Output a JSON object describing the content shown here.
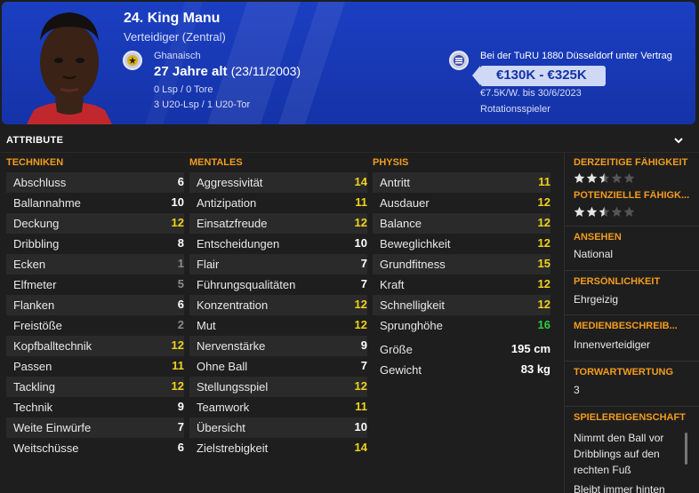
{
  "player": {
    "name": "24. King Manu",
    "position": "Verteidiger (Zentral)",
    "nationality": "Ghanaisch",
    "age": "27 Jahre alt",
    "dob": "(23/11/2003)",
    "caps_senior": "0 Lsp / 0 Tore",
    "caps_u20": "3 U20-Lsp / 1 U20-Tor",
    "contract": "Bei der TuRU 1880 Düsseldorf unter Vertrag",
    "value": "€130K - €325K",
    "wage": "€7.5K/W. bis 30/6/2023",
    "squad_role": "Rotationsspieler"
  },
  "section": {
    "title": "ATTRIBUTE"
  },
  "technical": {
    "header": "TECHNIKEN",
    "rows": [
      {
        "label": "Abschluss",
        "value": "6"
      },
      {
        "label": "Ballannahme",
        "value": "10"
      },
      {
        "label": "Deckung",
        "value": "12"
      },
      {
        "label": "Dribbling",
        "value": "8"
      },
      {
        "label": "Ecken",
        "value": "1"
      },
      {
        "label": "Elfmeter",
        "value": "5"
      },
      {
        "label": "Flanken",
        "value": "6"
      },
      {
        "label": "Freistöße",
        "value": "2"
      },
      {
        "label": "Kopfballtechnik",
        "value": "12"
      },
      {
        "label": "Passen",
        "value": "11"
      },
      {
        "label": "Tackling",
        "value": "12"
      },
      {
        "label": "Technik",
        "value": "9"
      },
      {
        "label": "Weite Einwürfe",
        "value": "7"
      },
      {
        "label": "Weitschüsse",
        "value": "6"
      }
    ]
  },
  "mental": {
    "header": "MENTALES",
    "rows": [
      {
        "label": "Aggressivität",
        "value": "14"
      },
      {
        "label": "Antizipation",
        "value": "11"
      },
      {
        "label": "Einsatzfreude",
        "value": "12"
      },
      {
        "label": "Entscheidungen",
        "value": "10"
      },
      {
        "label": "Flair",
        "value": "7"
      },
      {
        "label": "Führungsqualitäten",
        "value": "7"
      },
      {
        "label": "Konzentration",
        "value": "12"
      },
      {
        "label": "Mut",
        "value": "12"
      },
      {
        "label": "Nervenstärke",
        "value": "9"
      },
      {
        "label": "Ohne Ball",
        "value": "7"
      },
      {
        "label": "Stellungsspiel",
        "value": "12"
      },
      {
        "label": "Teamwork",
        "value": "11"
      },
      {
        "label": "Übersicht",
        "value": "10"
      },
      {
        "label": "Zielstrebigkeit",
        "value": "14"
      }
    ]
  },
  "physical": {
    "header": "PHYSIS",
    "rows": [
      {
        "label": "Antritt",
        "value": "11"
      },
      {
        "label": "Ausdauer",
        "value": "12"
      },
      {
        "label": "Balance",
        "value": "12"
      },
      {
        "label": "Beweglichkeit",
        "value": "12"
      },
      {
        "label": "Grundfitness",
        "value": "15"
      },
      {
        "label": "Kraft",
        "value": "12"
      },
      {
        "label": "Schnelligkeit",
        "value": "12"
      },
      {
        "label": "Sprunghöhe",
        "value": "16"
      }
    ],
    "height_label": "Größe",
    "height_value": "195 cm",
    "weight_label": "Gewicht",
    "weight_value": "83 kg"
  },
  "side": {
    "current_ability_label": "DERZEITIGE FÄHIGKEIT",
    "current_ability_stars": 2.5,
    "potential_ability_label": "POTENZIELLE FÄHIGK...",
    "potential_ability_stars": 2.5,
    "reputation_label": "ANSEHEN",
    "reputation_value": "National",
    "personality_label": "PERSÖNLICHKEIT",
    "personality_value": "Ehrgeizig",
    "media_label": "MEDIENBESCHREIB...",
    "media_value": "Innenverteidiger",
    "gk_rating_label": "TORWARTWERTUNG",
    "gk_rating_value": "3",
    "traits_label": "SPIELEREIGENSCHAFT",
    "trait_1_line1": "Nimmt den Ball vor",
    "trait_1_line2": "Dribblings auf den",
    "trait_1_line3": "rechten Fuß",
    "trait_2_line1": "Bleibt immer hinten"
  },
  "colors": {
    "banner": "#1533a8",
    "accent_orange": "#f39c1e",
    "value_white": "#ffffff",
    "value_yellow": "#f1d21b",
    "value_grey": "#8a8a8a",
    "value_green": "#2ecc40"
  }
}
